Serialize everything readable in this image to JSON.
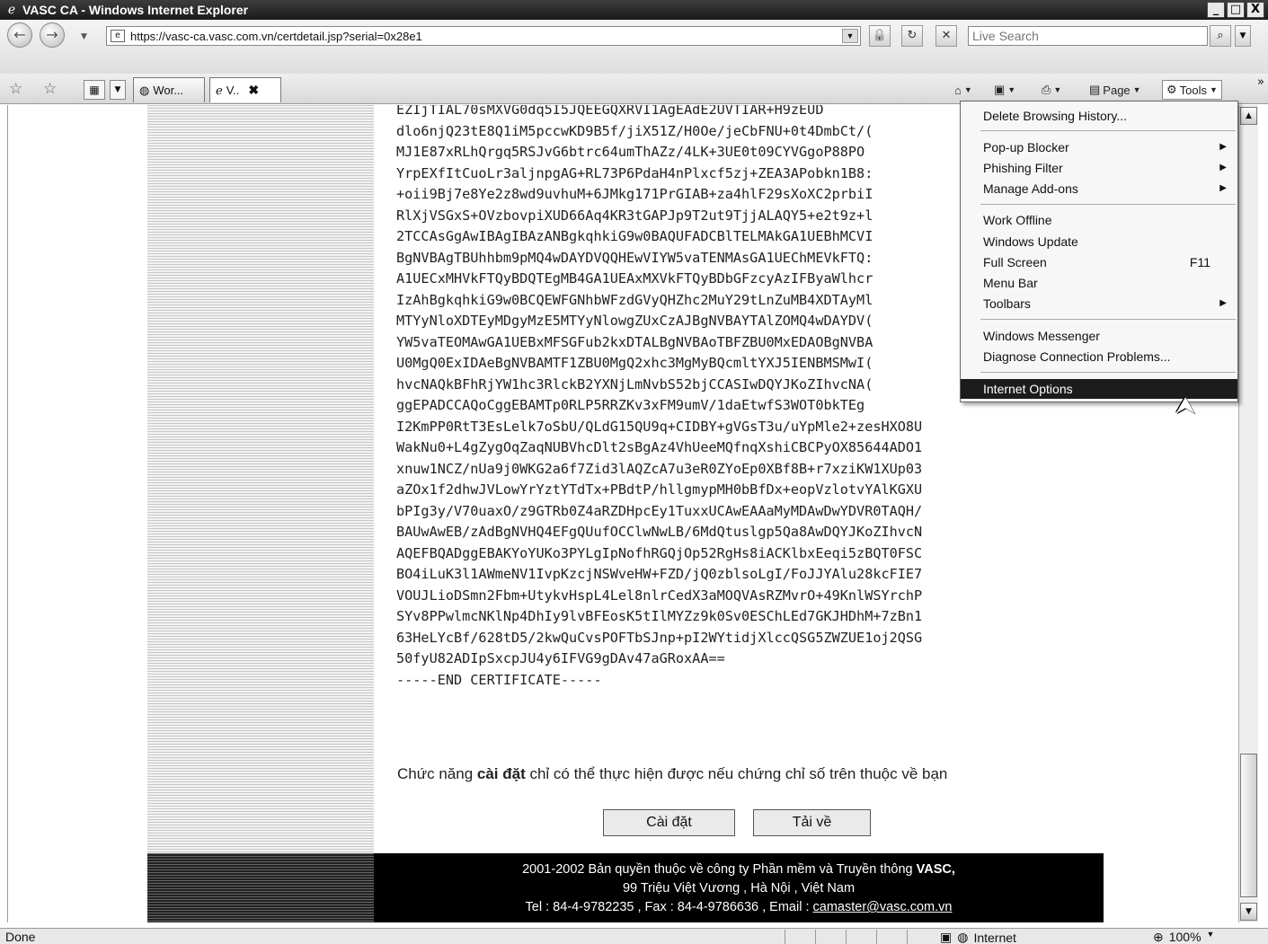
{
  "window": {
    "title": "VASC CA - Windows Internet Explorer",
    "minimize": "_",
    "maximize": "□",
    "close": "X"
  },
  "address": {
    "url": "https://vasc-ca.vasc.com.vn/certdetail.jsp?serial=0x28e1",
    "search_placeholder": "Live Search"
  },
  "tabs": [
    {
      "label": "Wor..."
    },
    {
      "label": "V..",
      "close": "✖"
    }
  ],
  "commands": {
    "page": "Page",
    "tools": "Tools"
  },
  "cert_lines": [
    "EZIjTIAL70sMXVG0dq5I5JQEEGQXRVI1AgEAdE2UVTIAR+H9zEUD",
    "dlo6njQ23tE8Q1iM5pccwKD9B5f/jiX51Z/H0Oe/jeCbFNU+0t4DmbCt/(",
    "MJ1E87xRLhQrgq5RSJvG6btrc64umThAZz/4LK+3UE0t09CYVGgoP88PO",
    "YrpEXfItCuoLr3aljnpgAG+RL73P6PdaH4nPlxcf5zj+ZEA3APobkn1B8:",
    "+oii9Bj7e8Ye2z8wd9uvhuM+6JMkg171PrGIAB+za4hlF29sXoXC2prbiI",
    "RlXjVSGxS+OVzbovpiXUD66Aq4KR3tGAPJp9T2ut9TjjALAQY5+e2t9z+l",
    "2TCCAsGgAwIBAgIBAzANBgkqhkiG9w0BAQUFADCBlTELMAkGA1UEBhMCVI",
    "BgNVBAgTBUhhbm9pMQ4wDAYDVQQHEwVIYW5vaTENMAsGA1UEChMEVkFTQ:",
    "A1UECxMHVkFTQyBDQTEgMB4GA1UEAxMXVkFTQyBDbGFzcyAzIFByaWlhcr",
    "IzAhBgkqhkiG9w0BCQEWFGNhbWFzdGVyQHZhc2MuY29tLnZuMB4XDTAyMl",
    "MTYyNloXDTEyMDgyMzE5MTYyNlowgZUxCzAJBgNVBAYTAlZOMQ4wDAYDV(",
    "YW5vaTEOMAwGA1UEBxMFSGFub2kxDTALBgNVBAoTBFZBU0MxEDAOBgNVBA",
    "U0MgQ0ExIDAeBgNVBAMTF1ZBU0MgQ2xhc3MgMyBQcmltYXJ5IENBMSMwI(",
    "hvcNAQkBFhRjYW1hc3RlckB2YXNjLmNvbS52bjCCASIwDQYJKoZIhvcNA(",
    "ggEPADCCAQoCggEBAMTp0RLP5RRZKv3xFM9umV/1daEtwfS3WOT0bkTEg",
    "I2KmPP0RtT3EsLelk7oSbU/QLdG15QU9q+CIDBY+gVGsT3u/uYpMle2+zesHXO8U",
    "WakNu0+L4gZygOqZaqNUBVhcDlt2sBgAz4VhUeeMQfnqXshiCBCPyOX85644ADO1",
    "xnuw1NCZ/nUa9j0WKG2a6f7Zid3lAQZcA7u3eR0ZYoEp0XBf8B+r7xziKW1XUp03",
    "aZOx1f2dhwJVLowYrYztYTdTx+PBdtP/hllgmypMH0bBfDx+eopVzlotvYAlKGXU",
    "bPIg3y/V70uaxO/z9GTRb0Z4aRZDHpcEy1TuxxUCAwEAAaMyMDAwDwYDVR0TAQH/",
    "BAUwAwEB/zAdBgNVHQ4EFgQUufOCClwNwLB/6MdQtuslgp5Qa8AwDQYJKoZIhvcN",
    "AQEFBQADggEBAKYoYUKo3PYLgIpNofhRGQjOp52RgHs8iACKlbxEeqi5zBQT0FSC",
    "BO4iLuK3l1AWmeNV1IvpKzcjNSWveHW+FZD/jQ0zblsoLgI/FoJJYAlu28kcFIE7",
    "VOUJLioDSmn2Fbm+UtykvHspL4Lel8nlrCedX3aMOQVAsRZMvrO+49KnlWSYrchP",
    "SYv8PPwlmcNKlNp4DhIy9lvBFEosK5tIlMYZz9k0Sv0ESChLEd7GKJHDhM+7zBn1",
    "63HeLYcBf/628tD5/2kwQuCvsPOFTbSJnp+pI2WYtidjXlccQSG5ZWZUE1oj2QSG",
    "50fyU82ADIpSxcpJU4y6IFVG9gDAv47aGRoxAA==",
    "-----END CERTIFICATE-----"
  ],
  "content": {
    "install_msg_pre": "Chức năng ",
    "install_msg_bold": "cài đặt",
    "install_msg_post": " chỉ có thể thực hiện được nếu chứng chỉ số trên thuộc về bạn",
    "btn_install": "Cài đặt",
    "btn_download": "Tải về"
  },
  "footer": {
    "line1_pre": "2001-2002 Bản quyền thuộc về công ty Phần mềm và Truyền thông ",
    "line1_bold": "VASC,",
    "line2": "99 Triệu Việt Vương , Hà Nội , Việt Nam",
    "line3_pre": "Tel : 84-4-9782235 , Fax : 84-4-9786636 , Email : ",
    "email": "camaster@vasc.com.vn"
  },
  "status": {
    "text": "Done",
    "zone": "Internet",
    "zoom": "100%"
  },
  "tools_menu": {
    "delete_history": "Delete Browsing History...",
    "popup_blocker": "Pop-up Blocker",
    "phishing_filter": "Phishing Filter",
    "manage_addons": "Manage Add-ons",
    "work_offline": "Work Offline",
    "windows_update": "Windows Update",
    "full_screen": "Full Screen",
    "full_screen_key": "F11",
    "menu_bar": "Menu Bar",
    "toolbars": "Toolbars",
    "messenger": "Windows Messenger",
    "diagnose": "Diagnose Connection Problems...",
    "internet_options": "Internet Options"
  }
}
